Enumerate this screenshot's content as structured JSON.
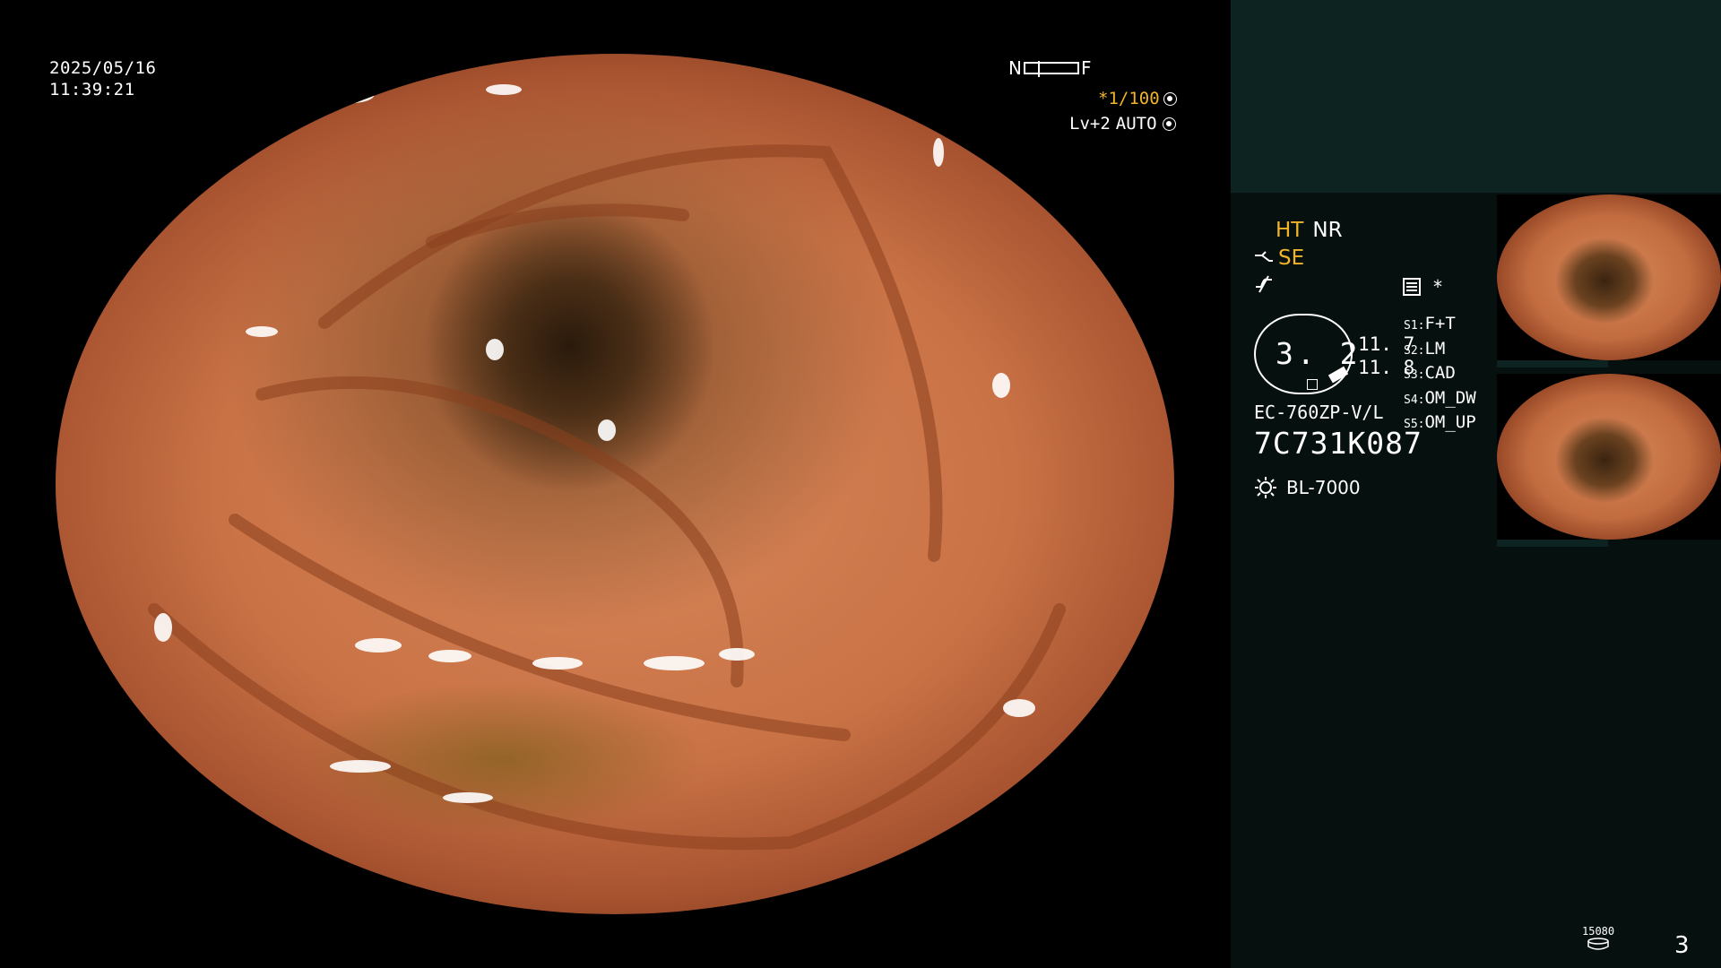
{
  "overlay": {
    "date": "2025/05/16",
    "time": "11:39:21",
    "nf_near": "N",
    "nf_far": "F",
    "zoom": "*1/100",
    "level": "Lv+2",
    "mode": "AUTO"
  },
  "settings": {
    "ht": "HT",
    "nr": "NR",
    "se": "SE",
    "asterisk": "*",
    "dial_value": "3. 2",
    "value_1": "11. 7",
    "value_2": "11. 8",
    "switches": [
      {
        "key": "S1:",
        "value": "F+T"
      },
      {
        "key": "S2:",
        "value": "LM"
      },
      {
        "key": "S3:",
        "value": "CAD"
      },
      {
        "key": "S4:",
        "value": "OM_DW"
      },
      {
        "key": "S5:",
        "value": "OM_UP"
      }
    ],
    "scope_model": "EC-760ZP-V/L",
    "serial": "7C731K087",
    "light_source": "BL-7000"
  },
  "footer": {
    "counter": "15080",
    "page": "3"
  },
  "colors": {
    "accent_yellow": "#f0b52a",
    "panel_dark": "#06100e",
    "panel_top": "#0d2321"
  }
}
